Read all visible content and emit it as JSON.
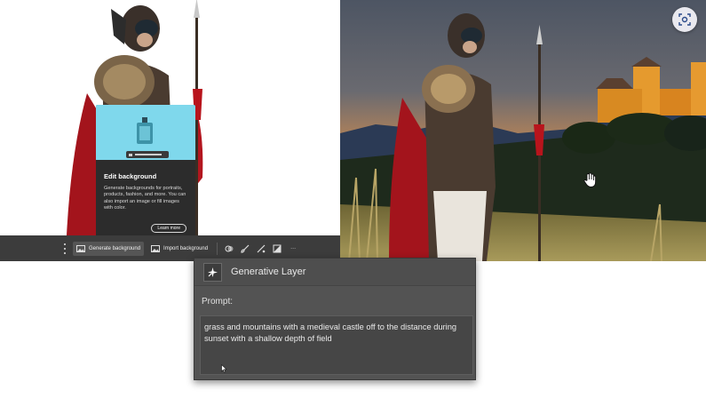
{
  "popup": {
    "title": "Edit background",
    "description": "Generate backgrounds for portraits, products, fashion, and more. You can also import an image or fill images with color.",
    "learn_more": "Learn more"
  },
  "taskbar": {
    "generate_background": "Generate background",
    "import_background": "Import background",
    "more": "···"
  },
  "generative_panel": {
    "title": "Generative Layer",
    "prompt_label": "Prompt:",
    "prompt_text": "grass and mountains with a medieval castle off to the distance during sunset with a shallow depth of field"
  },
  "icons": {
    "lens": "visual-search-icon",
    "sparkle": "generative-sparkle-icon",
    "hand": "hand-cursor-icon",
    "pointer": "arrow-pointer-icon"
  },
  "colors": {
    "taskbar_bg": "#3c3c3c",
    "panel_bg": "#535353",
    "popup_bg": "#2c2c2c",
    "thumb_bg": "#7fd8ec"
  }
}
